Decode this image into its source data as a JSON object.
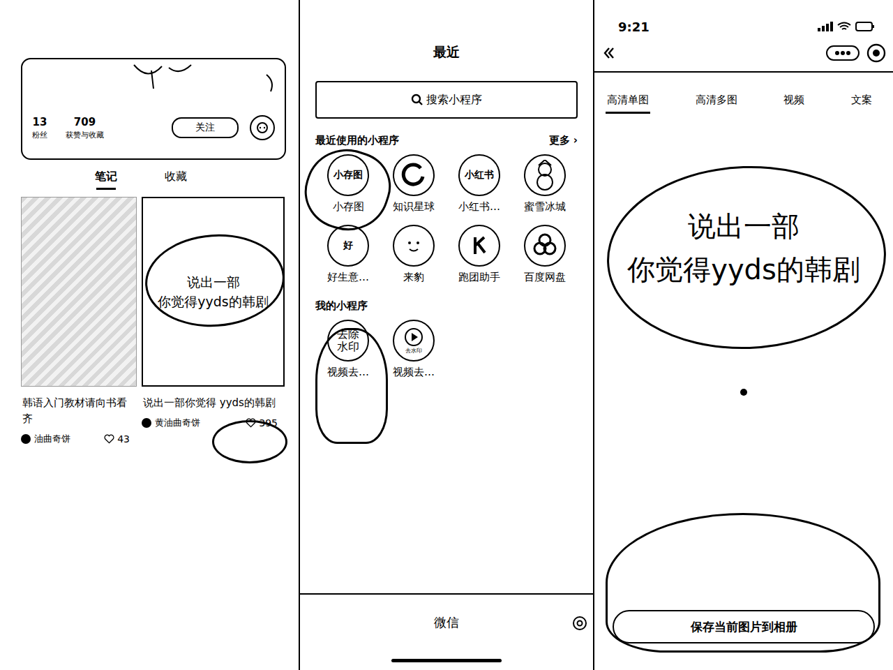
{
  "profile": {
    "stats": [
      {
        "value": "13",
        "label": "粉丝"
      },
      {
        "value": "709",
        "label": "获赞与收藏"
      }
    ],
    "follow_button": "关注",
    "tabs": [
      {
        "label": "笔记",
        "selected": true
      },
      {
        "label": "收藏",
        "selected": false
      }
    ],
    "notes": [
      {
        "kind": "photo",
        "title": "韩语入门教材请向书看齐",
        "author": "油曲奇饼",
        "likes": "43"
      },
      {
        "kind": "text-card",
        "card_lines": [
          "说出一部",
          "你觉得yyds的韩剧"
        ],
        "title": "说出一部你觉得 yyds的韩剧",
        "author": "黄油曲奇饼",
        "likes": "395"
      }
    ]
  },
  "mini_programs": {
    "title": "最近",
    "search": {
      "placeholder": "搜索小程序"
    },
    "recent": {
      "title": "最近使用的小程序",
      "more": "更多 ›",
      "apps": [
        {
          "name": "小存图",
          "kind": "text",
          "icon_text": "小存图"
        },
        {
          "name": "知识星球",
          "kind": "ring"
        },
        {
          "name": "小红书…",
          "kind": "text",
          "icon_text": "小红书"
        },
        {
          "name": "蜜雪冰城",
          "kind": "snowman"
        },
        {
          "name": "好生意…",
          "kind": "text",
          "icon_text": "好"
        },
        {
          "name": "来豹",
          "kind": "seal"
        },
        {
          "name": "跑团助手",
          "kind": "runner"
        },
        {
          "name": "百度网盘",
          "kind": "cloud"
        }
      ]
    },
    "mine": {
      "title": "我的小程序",
      "apps": [
        {
          "name": "视频去…",
          "kind": "watermark",
          "icon_text": "去除水印"
        },
        {
          "name": "视频去…",
          "kind": "play",
          "icon_text": "去水印"
        }
      ]
    },
    "tab_bar": {
      "label": "微信"
    }
  },
  "saver": {
    "status_bar": {
      "time": "9:21"
    },
    "tabs": [
      {
        "label": "高清单图",
        "selected": true
      },
      {
        "label": "高清多图",
        "selected": false
      },
      {
        "label": "视频",
        "selected": false
      },
      {
        "label": "文案",
        "selected": false
      }
    ],
    "preview_lines": [
      "说出一部",
      "你觉得yyds的韩剧"
    ],
    "save_button": "保存当前图片到相册"
  }
}
